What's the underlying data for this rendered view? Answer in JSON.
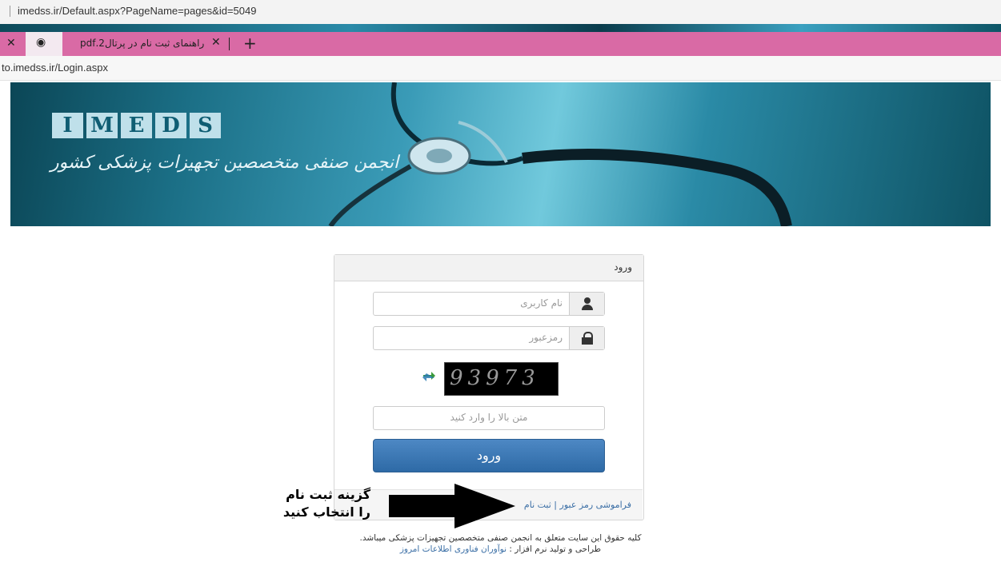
{
  "browser": {
    "url_top": "imedss.ir/Default.aspx?PageName=pages&id=5049",
    "tab_title": "راهنمای ثبت نام در پرتال2.pdf",
    "url_login": "to.imedss.ir/Login.aspx"
  },
  "banner": {
    "logo_letters": [
      "I",
      "M",
      "E",
      "D",
      "S"
    ],
    "tagline": "انجمن صنفی متخصصین تجهیزات پزشکی کشور"
  },
  "login": {
    "title": "ورود",
    "username_placeholder": "نام کاربری",
    "password_placeholder": "رمزعبور",
    "captcha_text": "93973",
    "captcha_placeholder": "متن بالا را وارد کنید",
    "submit_label": "ورود",
    "links_text": "فراموشی رمز عبور | ثبت نام"
  },
  "annotation": {
    "line1": "گزینه ثبت نام",
    "line2": "را انتخاب کنید"
  },
  "footer": {
    "copyright": "کلیه حقوق این سایت متعلق به انجمن صنفی متخصصین تجهیزات پزشکی میباشد.",
    "credit_prefix": "طراحی و تولید نرم افزار : ",
    "credit_company": "نوآوران فناوری اطلاعات امروز"
  },
  "colors": {
    "tab_bar": "#d96aa5",
    "button": "#3a76b3",
    "link": "#3a6ea5"
  }
}
